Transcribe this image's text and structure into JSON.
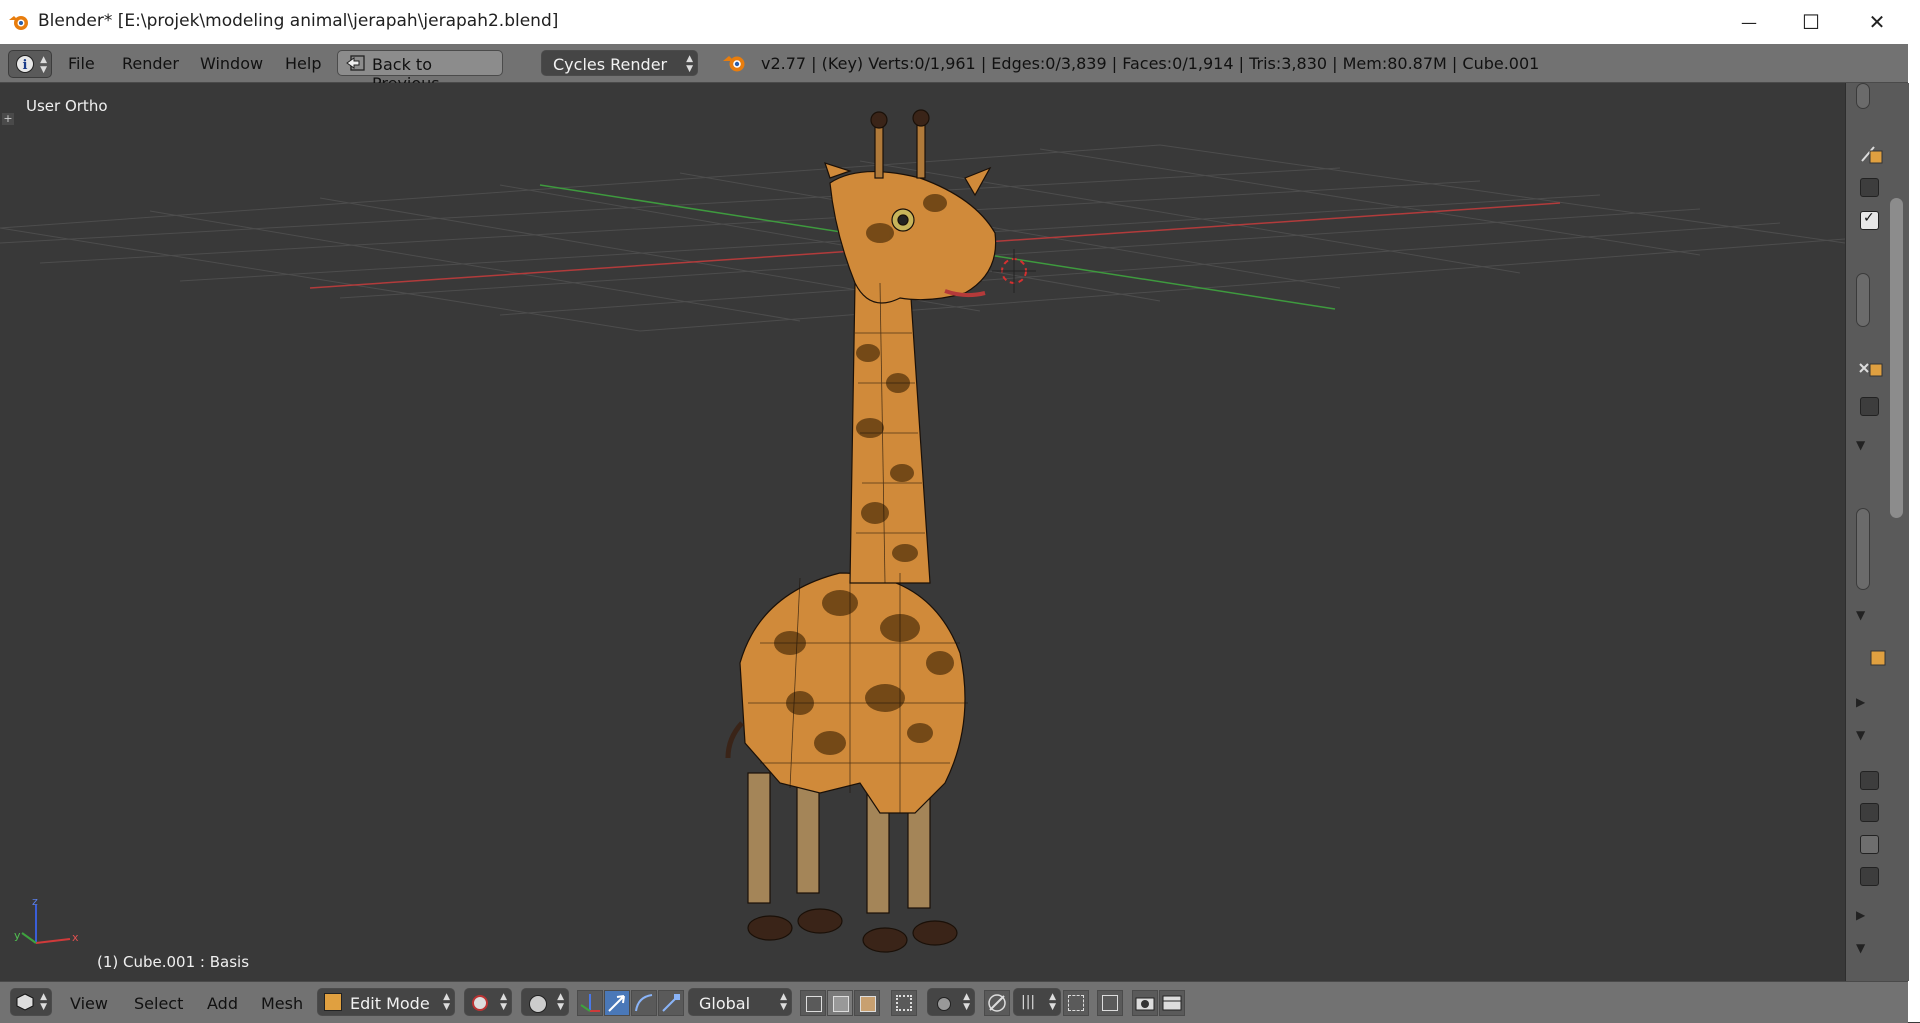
{
  "window": {
    "title": "Blender* [E:\\projek\\modeling animal\\jerapah\\jerapah2.blend]",
    "minimize_glyph": "—",
    "maximize_glyph": "☐",
    "close_glyph": "✕"
  },
  "menubar": {
    "items": [
      "File",
      "Render",
      "Window",
      "Help"
    ],
    "back_button": "Back to Previous",
    "render_engine": "Cycles Render",
    "status": "v2.77 | (Key) Verts:0/1,961 | Edges:0/3,839 | Faces:0/1,914 | Tris:3,830 | Mem:80.87M | Cube.001"
  },
  "viewport": {
    "view_label": "User Ortho",
    "object_label": "(1) Cube.001 : Basis",
    "axis_labels": {
      "x": "x",
      "y": "y",
      "z": "z"
    }
  },
  "bottombar": {
    "menus": [
      "View",
      "Select",
      "Add",
      "Mesh"
    ],
    "mode": "Edit Mode",
    "orientation": "Global"
  },
  "colors": {
    "header_bg": "#727272",
    "viewport_bg": "#393939",
    "axis_red": "#c0392b",
    "axis_green": "#3aa13a",
    "giraffe_orange": "#d08a3a",
    "active_blue": "#4a78b8"
  },
  "icons": [
    "blender-logo-icon",
    "info-editor-icon",
    "back-arrow-icon",
    "3d-view-editor-icon",
    "edit-mode-icon",
    "viewport-shading-icon",
    "pivot-icon",
    "manipulator-icon",
    "translate-icon",
    "rotate-icon",
    "scale-icon",
    "vertex-select-icon",
    "edge-select-icon",
    "face-select-icon",
    "occlude-icon",
    "proportional-edit-icon",
    "snap-icon",
    "render-icon",
    "anim-render-icon"
  ]
}
